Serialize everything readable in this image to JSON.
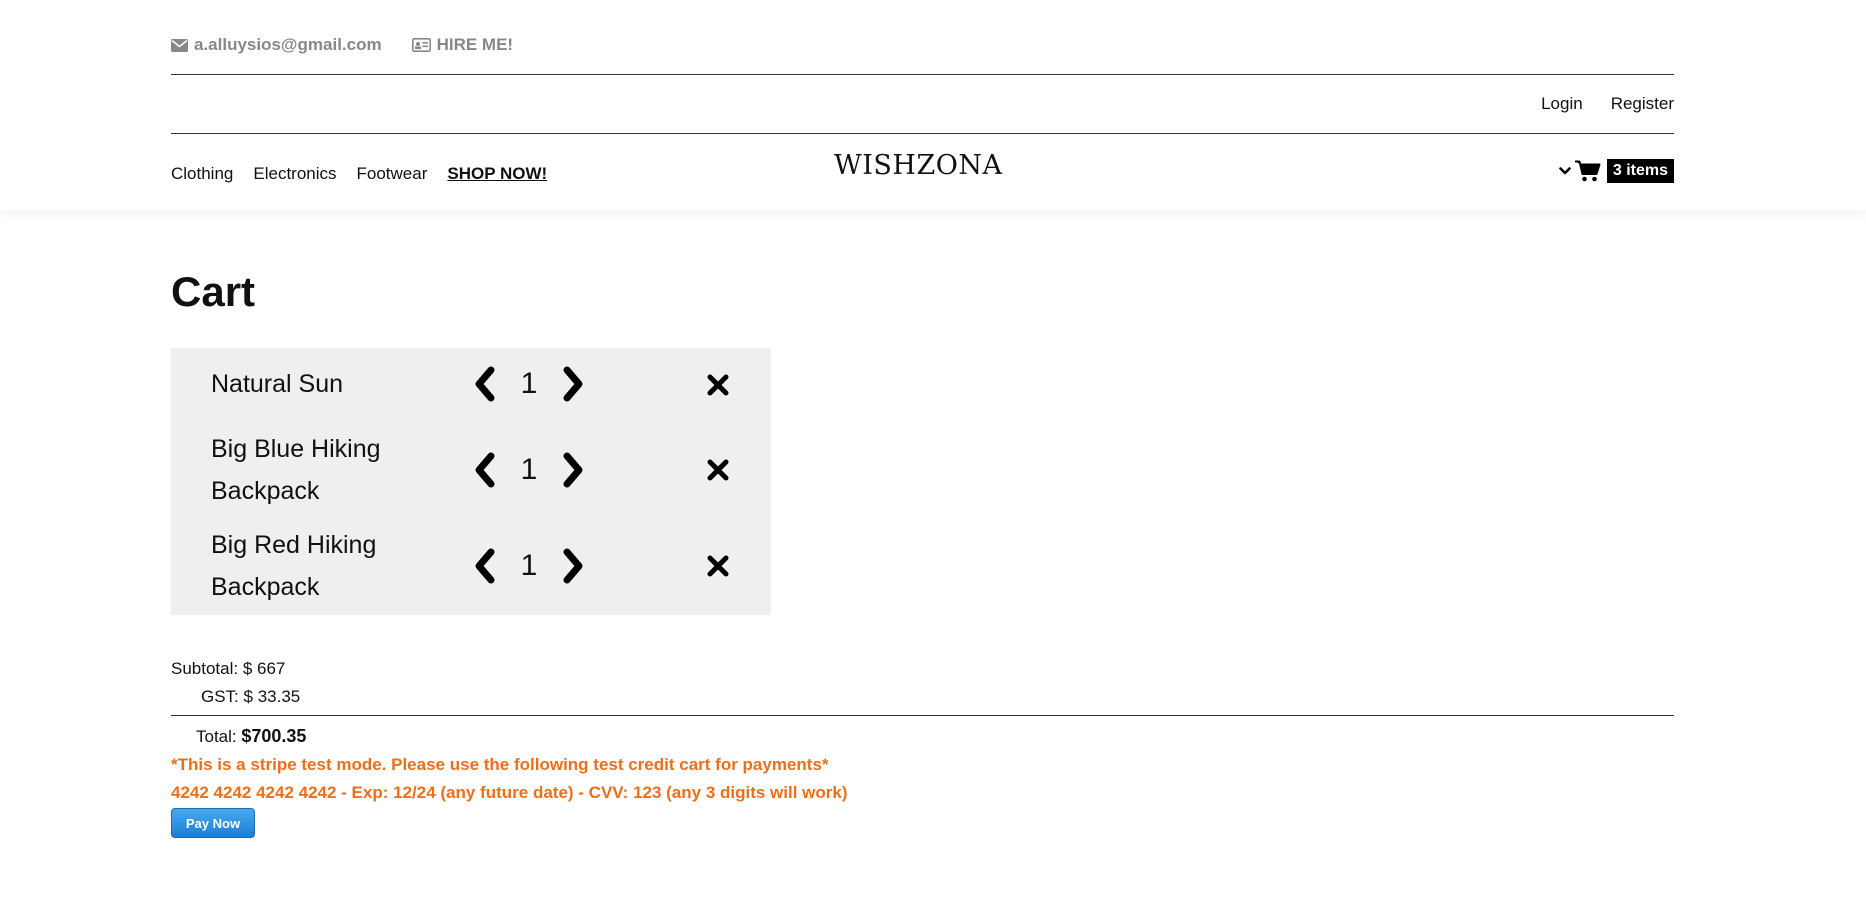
{
  "top_bar": {
    "email": "a.alluysios@gmail.com",
    "hire_label": "HIRE ME!"
  },
  "auth": {
    "login": "Login",
    "register": "Register"
  },
  "nav": {
    "items": [
      "Clothing",
      "Electronics",
      "Footwear"
    ],
    "shop_now": "SHOP NOW!"
  },
  "logo": "WISHZONA",
  "cart_widget": {
    "count_label": "3 items"
  },
  "page_title": "Cart",
  "cart_items": [
    {
      "name": "Natural Sun",
      "qty": "1"
    },
    {
      "name": "Big Blue Hiking Backpack",
      "qty": "1"
    },
    {
      "name": "Big Red Hiking Backpack",
      "qty": "1"
    }
  ],
  "totals": {
    "subtotal_label": "Subtotal:",
    "subtotal_value": "$ 667",
    "gst_label": "GST:",
    "gst_value": "$ 33.35",
    "total_label": "Total:",
    "total_value": "$700.35"
  },
  "notice": {
    "line1": "*This is a stripe test mode. Please use the following test credit cart for payments*",
    "line2": "4242 4242 4242 4242 - Exp: 12/24 (any future date) - CVV: 123 (any 3 digits will work)"
  },
  "pay_button": "Pay Now",
  "colors": {
    "accent_orange": "#ec6f1c",
    "pay_button_blue": "#1a7fd4",
    "cart_bg": "#efefef"
  }
}
